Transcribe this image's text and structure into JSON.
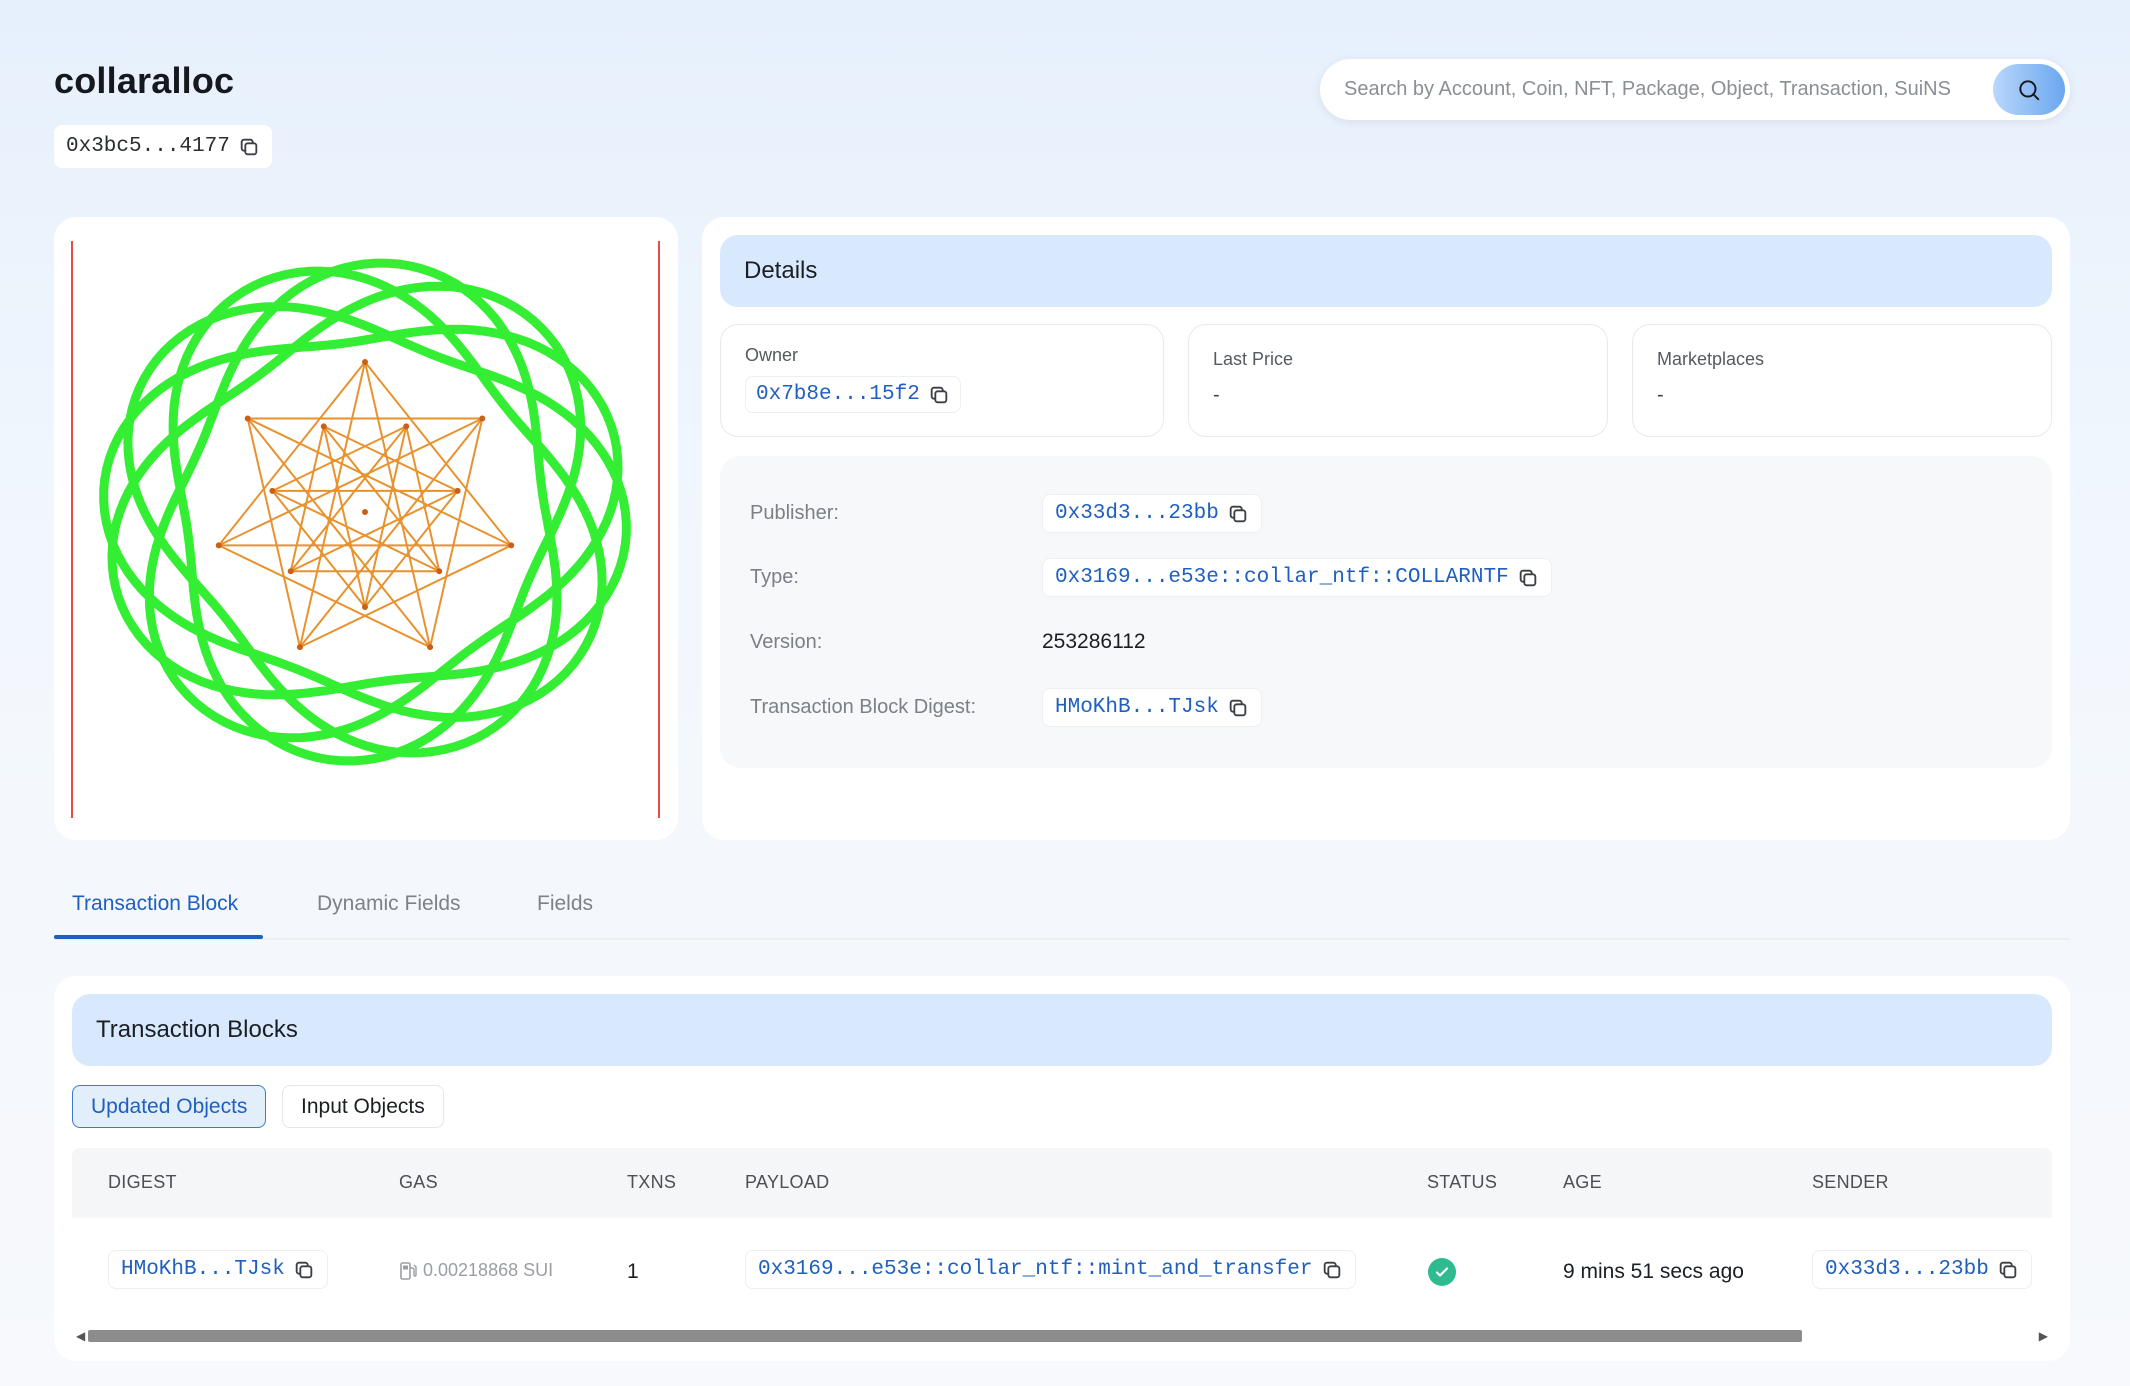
{
  "header": {
    "title": "collaralloc",
    "object_address": "0x3bc5...4177"
  },
  "search": {
    "placeholder": "Search by Account, Coin, NFT, Package, Object, Transaction, SuiNS"
  },
  "details": {
    "title": "Details",
    "owner_label": "Owner",
    "owner_value": "0x7b8e...15f2",
    "last_price_label": "Last Price",
    "last_price_value": "-",
    "marketplaces_label": "Marketplaces",
    "marketplaces_value": "-",
    "rows": {
      "publisher_label": "Publisher:",
      "publisher_value": "0x33d3...23bb",
      "type_label": "Type:",
      "type_value": "0x3169...e53e::collar_ntf::COLLARNTF",
      "version_label": "Version:",
      "version_value": "253286112",
      "digest_label": "Transaction Block Digest:",
      "digest_value": "HMoKhB...TJsk"
    }
  },
  "tabs": [
    "Transaction Block",
    "Dynamic Fields",
    "Fields"
  ],
  "tx_blocks": {
    "title": "Transaction Blocks",
    "toggle_updated": "Updated Objects",
    "toggle_input": "Input Objects",
    "columns": [
      "DIGEST",
      "GAS",
      "TXNS",
      "PAYLOAD",
      "STATUS",
      "AGE",
      "SENDER"
    ],
    "row": {
      "digest": "HMoKhB...TJsk",
      "gas": "0.00218868 SUI",
      "txns": "1",
      "payload": "0x3169...e53e::collar_ntf::mint_and_transfer",
      "status": "success",
      "age": "9 mins 51 secs ago",
      "sender": "0x33d3...23bb"
    }
  },
  "colors": {
    "accent": "#1f5fbf",
    "header_blue": "#d8e9fd",
    "success": "#2dbb8f",
    "nft_curve": "#33ee33",
    "nft_star": "#e8922e",
    "nft_border": "#d11"
  },
  "icons": {
    "copy": "copy-icon",
    "search": "search-icon",
    "gas": "gas-pump-icon",
    "status": "check-circle-icon"
  }
}
